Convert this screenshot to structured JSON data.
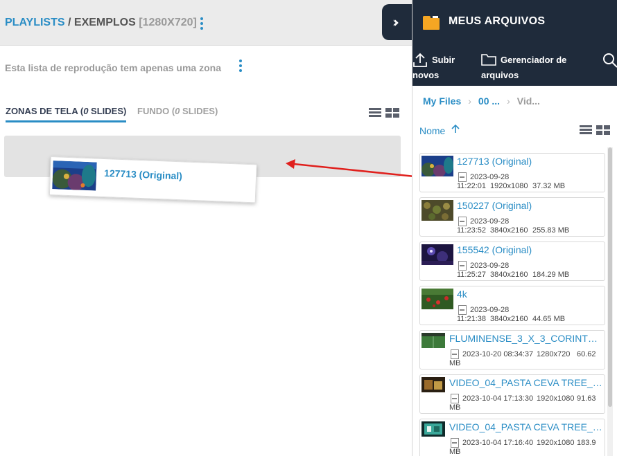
{
  "header": {
    "crumb_playlists": "PLAYLISTS",
    "crumb_sep": " / ",
    "crumb_name": "EXEMPLOS",
    "crumb_res": "[1280X720]"
  },
  "info_text": "Esta lista de reprodução tem apenas uma zona",
  "tabs": {
    "zones_prefix": "ZONAS DE TELA (",
    "zones_count": "0",
    "zones_suffix": " SLIDES)",
    "bg_prefix": "FUNDO (",
    "bg_count": "0",
    "bg_suffix": " SLIDES)"
  },
  "drag_item": {
    "label": "127713 (Original)"
  },
  "panel": {
    "title": "MEUS ARQUIVOS",
    "upload_line1": "Subir",
    "upload_line2": "novos",
    "manager_line1": "Gerenciador de",
    "manager_line2": "arquivos",
    "breadcrumb": [
      "My Files",
      "00 ...",
      "Vid..."
    ],
    "sort_label": "Nome"
  },
  "files": [
    {
      "name": "127713 (Original)",
      "date": "2023-09-28",
      "time": "11:22:01",
      "res": "1920x1080",
      "size": "37.32 MB",
      "thumb": "aquarium"
    },
    {
      "name": "150227 (Original)",
      "date": "2023-09-28",
      "time": "11:23:52",
      "res": "3840x2160",
      "size": "255.83 MB",
      "thumb": "leaves"
    },
    {
      "name": "155542 (Original)",
      "date": "2023-09-28",
      "time": "11:25:27",
      "res": "3840x2160",
      "size": "184.29 MB",
      "thumb": "night"
    },
    {
      "name": "4k",
      "date": "2023-09-28",
      "time": "11:21:38",
      "res": "3840x2160",
      "size": "44.65 MB",
      "thumb": "flowers"
    },
    {
      "name": "FLUMINENSE_3_X_3_CORINTHIA...",
      "datetime": "2023-10-20 08:34:37",
      "res": "1280x720",
      "size_a": "60.62",
      "size_b": "MB",
      "thumb": "field"
    },
    {
      "name": "VIDEO_04_PASTA CEVA TREE_Alt...",
      "datetime": "2023-10-04 17:13:30",
      "res": "1920x1080",
      "size_a": "91.63",
      "size_b": "MB",
      "thumb": "brown"
    },
    {
      "name": "VIDEO_04_PASTA CEVA TREE_Alt...",
      "datetime": "2023-10-04 17:16:40",
      "res": "1920x1080",
      "size_a": "183.9",
      "size_b": "MB",
      "thumb": "green"
    }
  ],
  "colors": {
    "accent": "#2a8dc5",
    "panel_dark": "#1f2b3b",
    "folder": "#f5a623",
    "arrow": "#e0201d"
  },
  "icons": [
    "kebab-icon",
    "list-view-icon",
    "grid-view-icon",
    "expand-chevrons-icon",
    "folder-icon",
    "upload-icon",
    "folder-outline-icon",
    "search-icon",
    "sort-arrow-up-icon",
    "film-icon"
  ]
}
